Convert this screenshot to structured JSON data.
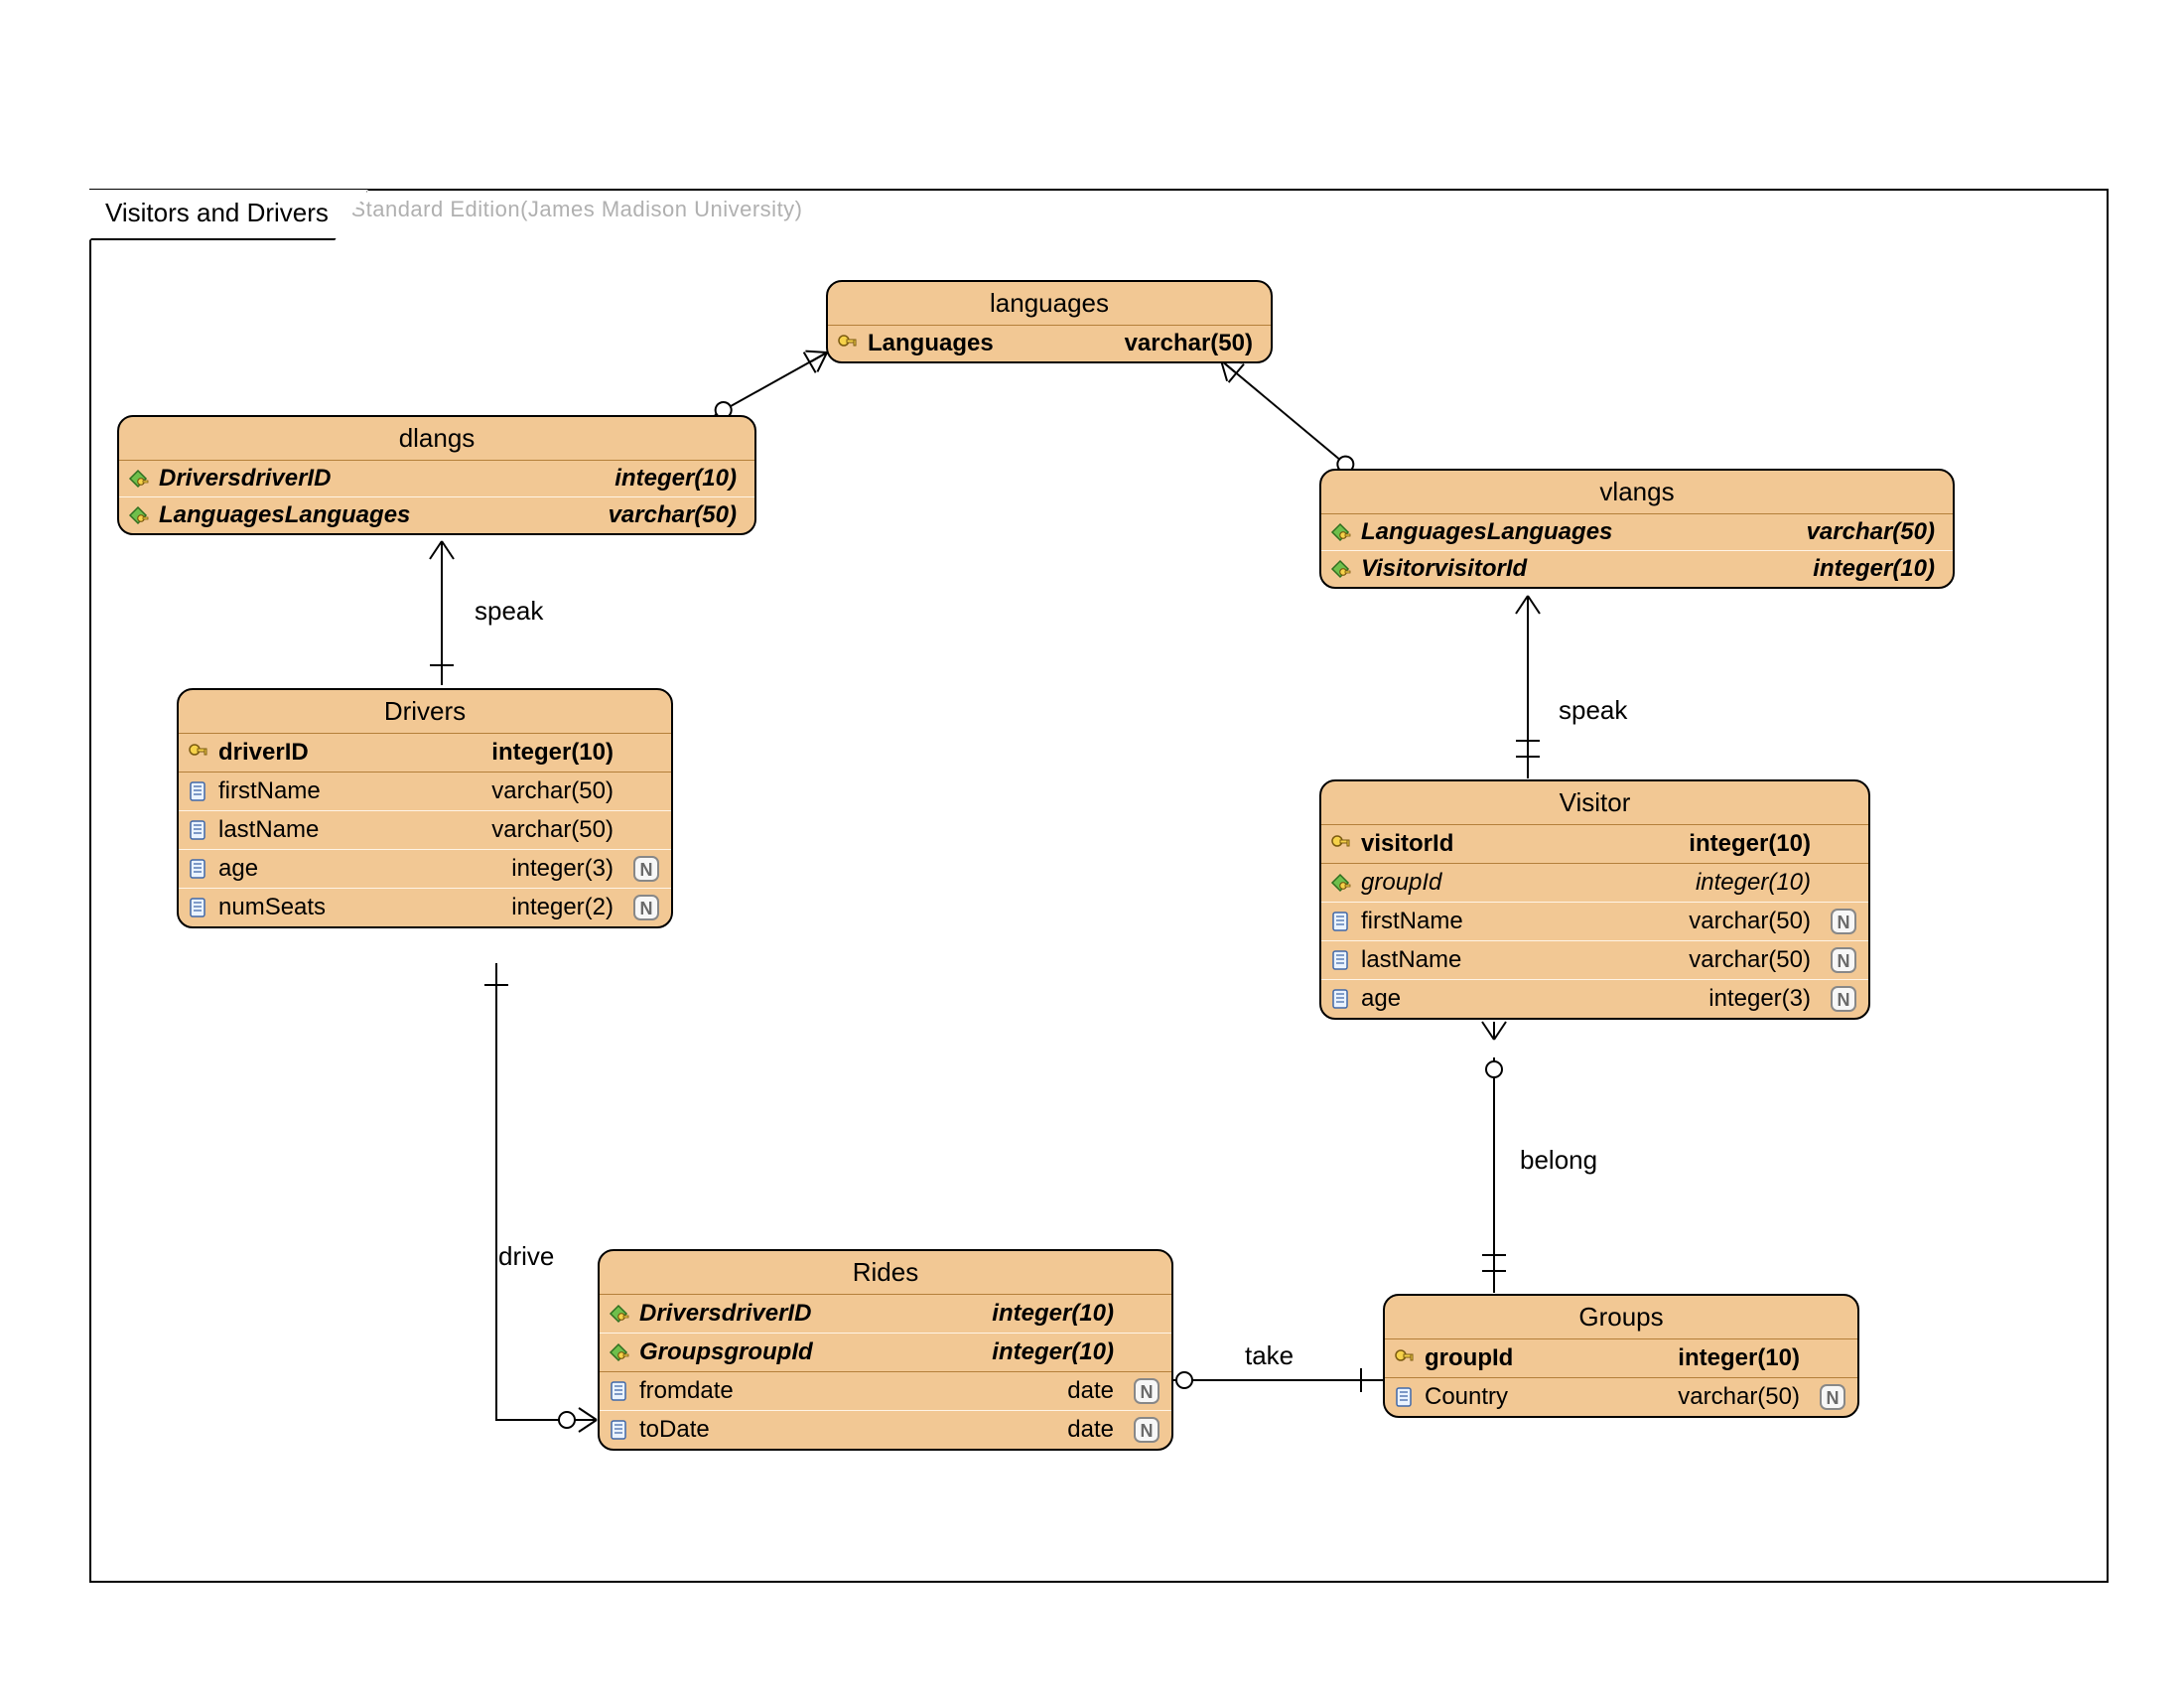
{
  "frame_title": "Visitors and Drivers",
  "watermark": "Visual Paradigm for UML Standard Edition(James Madison University)",
  "relationships": {
    "dlangs_drivers": "speak",
    "vlangs_visitor": "speak",
    "drivers_rides": "drive",
    "rides_groups": "take",
    "visitor_groups": "belong"
  },
  "entities": {
    "languages": {
      "title": "languages",
      "cols": [
        {
          "icon": "pk",
          "name": "Languages",
          "type": "varchar(50)",
          "bold": true
        }
      ]
    },
    "dlangs": {
      "title": "dlangs",
      "cols": [
        {
          "icon": "fk",
          "name": "DriversdriverID",
          "type": "integer(10)",
          "bold": true,
          "italic": true
        },
        {
          "icon": "fk",
          "name": "LanguagesLanguages",
          "type": "varchar(50)",
          "bold": true,
          "italic": true
        }
      ]
    },
    "vlangs": {
      "title": "vlangs",
      "cols": [
        {
          "icon": "fk",
          "name": "LanguagesLanguages",
          "type": "varchar(50)",
          "bold": true,
          "italic": true
        },
        {
          "icon": "fk",
          "name": "VisitorvisitorId",
          "type": "integer(10)",
          "bold": true,
          "italic": true
        }
      ]
    },
    "drivers": {
      "title": "Drivers",
      "cols": [
        {
          "icon": "pk",
          "name": "driverID",
          "type": "integer(10)",
          "bold": true
        },
        {
          "icon": "col",
          "name": "firstName",
          "type": "varchar(50)"
        },
        {
          "icon": "col",
          "name": "lastName",
          "type": "varchar(50)"
        },
        {
          "icon": "col",
          "name": "age",
          "type": "integer(3)",
          "nullable": true
        },
        {
          "icon": "col",
          "name": "numSeats",
          "type": "integer(2)",
          "nullable": true
        }
      ]
    },
    "visitor": {
      "title": "Visitor",
      "cols": [
        {
          "icon": "pk",
          "name": "visitorId",
          "type": "integer(10)",
          "bold": true
        },
        {
          "icon": "fk",
          "name": "groupId",
          "type": "integer(10)",
          "italic": true
        },
        {
          "icon": "col",
          "name": "firstName",
          "type": "varchar(50)",
          "nullable": true
        },
        {
          "icon": "col",
          "name": "lastName",
          "type": "varchar(50)",
          "nullable": true
        },
        {
          "icon": "col",
          "name": "age",
          "type": "integer(3)",
          "nullable": true
        }
      ]
    },
    "rides": {
      "title": "Rides",
      "cols": [
        {
          "icon": "fk",
          "name": "DriversdriverID",
          "type": "integer(10)",
          "bold": true,
          "italic": true
        },
        {
          "icon": "fk",
          "name": "GroupsgroupId",
          "type": "integer(10)",
          "bold": true,
          "italic": true
        },
        {
          "icon": "col",
          "name": "fromdate",
          "type": "date",
          "nullable": true
        },
        {
          "icon": "col",
          "name": "toDate",
          "type": "date",
          "nullable": true
        }
      ]
    },
    "groups": {
      "title": "Groups",
      "cols": [
        {
          "icon": "pk",
          "name": "groupId",
          "type": "integer(10)",
          "bold": true
        },
        {
          "icon": "col",
          "name": "Country",
          "type": "varchar(50)",
          "nullable": true
        }
      ]
    }
  }
}
